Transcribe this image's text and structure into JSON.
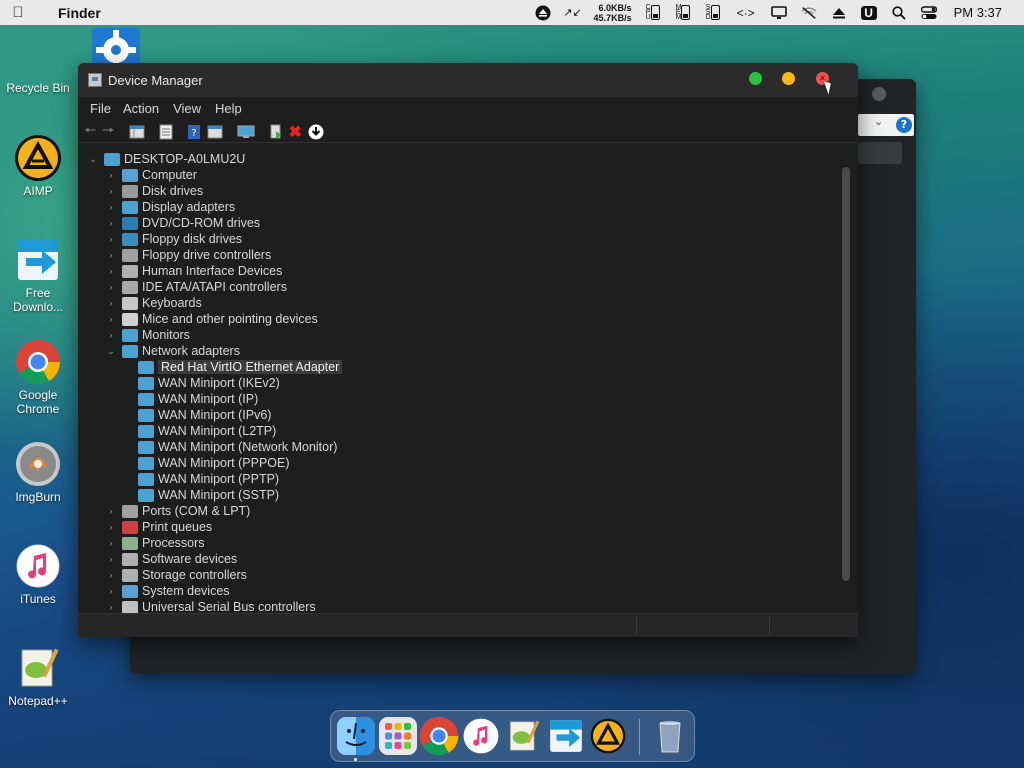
{
  "menubar": {
    "app_name": "Finder",
    "net_up": "6.0KB/s",
    "net_down": "45.7KB/s",
    "clock": "PM 3:37",
    "u_badge": "U"
  },
  "desktop": {
    "icons": [
      {
        "label": "Recycle Bin",
        "icon": "settings-gear-icon"
      },
      {
        "label": "AIMP",
        "icon": "aimp-icon"
      },
      {
        "label": "Free Downlo...",
        "icon": "free-download-icon"
      },
      {
        "label": "Google Chrome",
        "icon": "chrome-icon"
      },
      {
        "label": "ImgBurn",
        "icon": "imgburn-icon"
      },
      {
        "label": "iTunes",
        "icon": "itunes-icon"
      },
      {
        "label": "Notepad++",
        "icon": "notepad-icon"
      }
    ]
  },
  "window": {
    "title": "Device Manager",
    "menu": [
      "File",
      "Action",
      "View",
      "Help"
    ],
    "root": "DESKTOP-A0LMU2U",
    "categories": [
      {
        "label": "Computer",
        "color": "#5aa0d8"
      },
      {
        "label": "Disk drives",
        "color": "#9a9a9a"
      },
      {
        "label": "Display adapters",
        "color": "#4aa3d4"
      },
      {
        "label": "DVD/CD-ROM drives",
        "color": "#2a7fb0"
      },
      {
        "label": "Floppy disk drives",
        "color": "#3a8cc0"
      },
      {
        "label": "Floppy drive controllers",
        "color": "#a0a0a0"
      },
      {
        "label": "Human Interface Devices",
        "color": "#b0b0b0"
      },
      {
        "label": "IDE ATA/ATAPI controllers",
        "color": "#a8a8a8"
      },
      {
        "label": "Keyboards",
        "color": "#c8c8c8"
      },
      {
        "label": "Mice and other pointing devices",
        "color": "#d0d0d0"
      },
      {
        "label": "Monitors",
        "color": "#4aa3d4"
      },
      {
        "label": "Network adapters",
        "color": "#4aa3d4"
      }
    ],
    "network_children": [
      "Red Hat VirtIO Ethernet Adapter",
      "WAN Miniport (IKEv2)",
      "WAN Miniport (IP)",
      "WAN Miniport (IPv6)",
      "WAN Miniport (L2TP)",
      "WAN Miniport (Network Monitor)",
      "WAN Miniport (PPPOE)",
      "WAN Miniport (PPTP)",
      "WAN Miniport (SSTP)"
    ],
    "categories_after": [
      {
        "label": "Ports (COM & LPT)",
        "color": "#a0a0a0"
      },
      {
        "label": "Print queues",
        "color": "#d04040"
      },
      {
        "label": "Processors",
        "color": "#8fb08f"
      },
      {
        "label": "Software devices",
        "color": "#b0b0b0"
      },
      {
        "label": "Storage controllers",
        "color": "#b0b0b0"
      },
      {
        "label": "System devices",
        "color": "#5aa0d8"
      },
      {
        "label": "Universal Serial Bus controllers",
        "color": "#c0c0c0"
      }
    ],
    "selected_index": 0
  },
  "dock": {
    "apps": [
      "finder-icon",
      "launchpad-icon",
      "chrome-icon",
      "itunes-icon",
      "notepad-icon",
      "free-download-icon",
      "aimp-icon",
      "trash-icon"
    ]
  }
}
